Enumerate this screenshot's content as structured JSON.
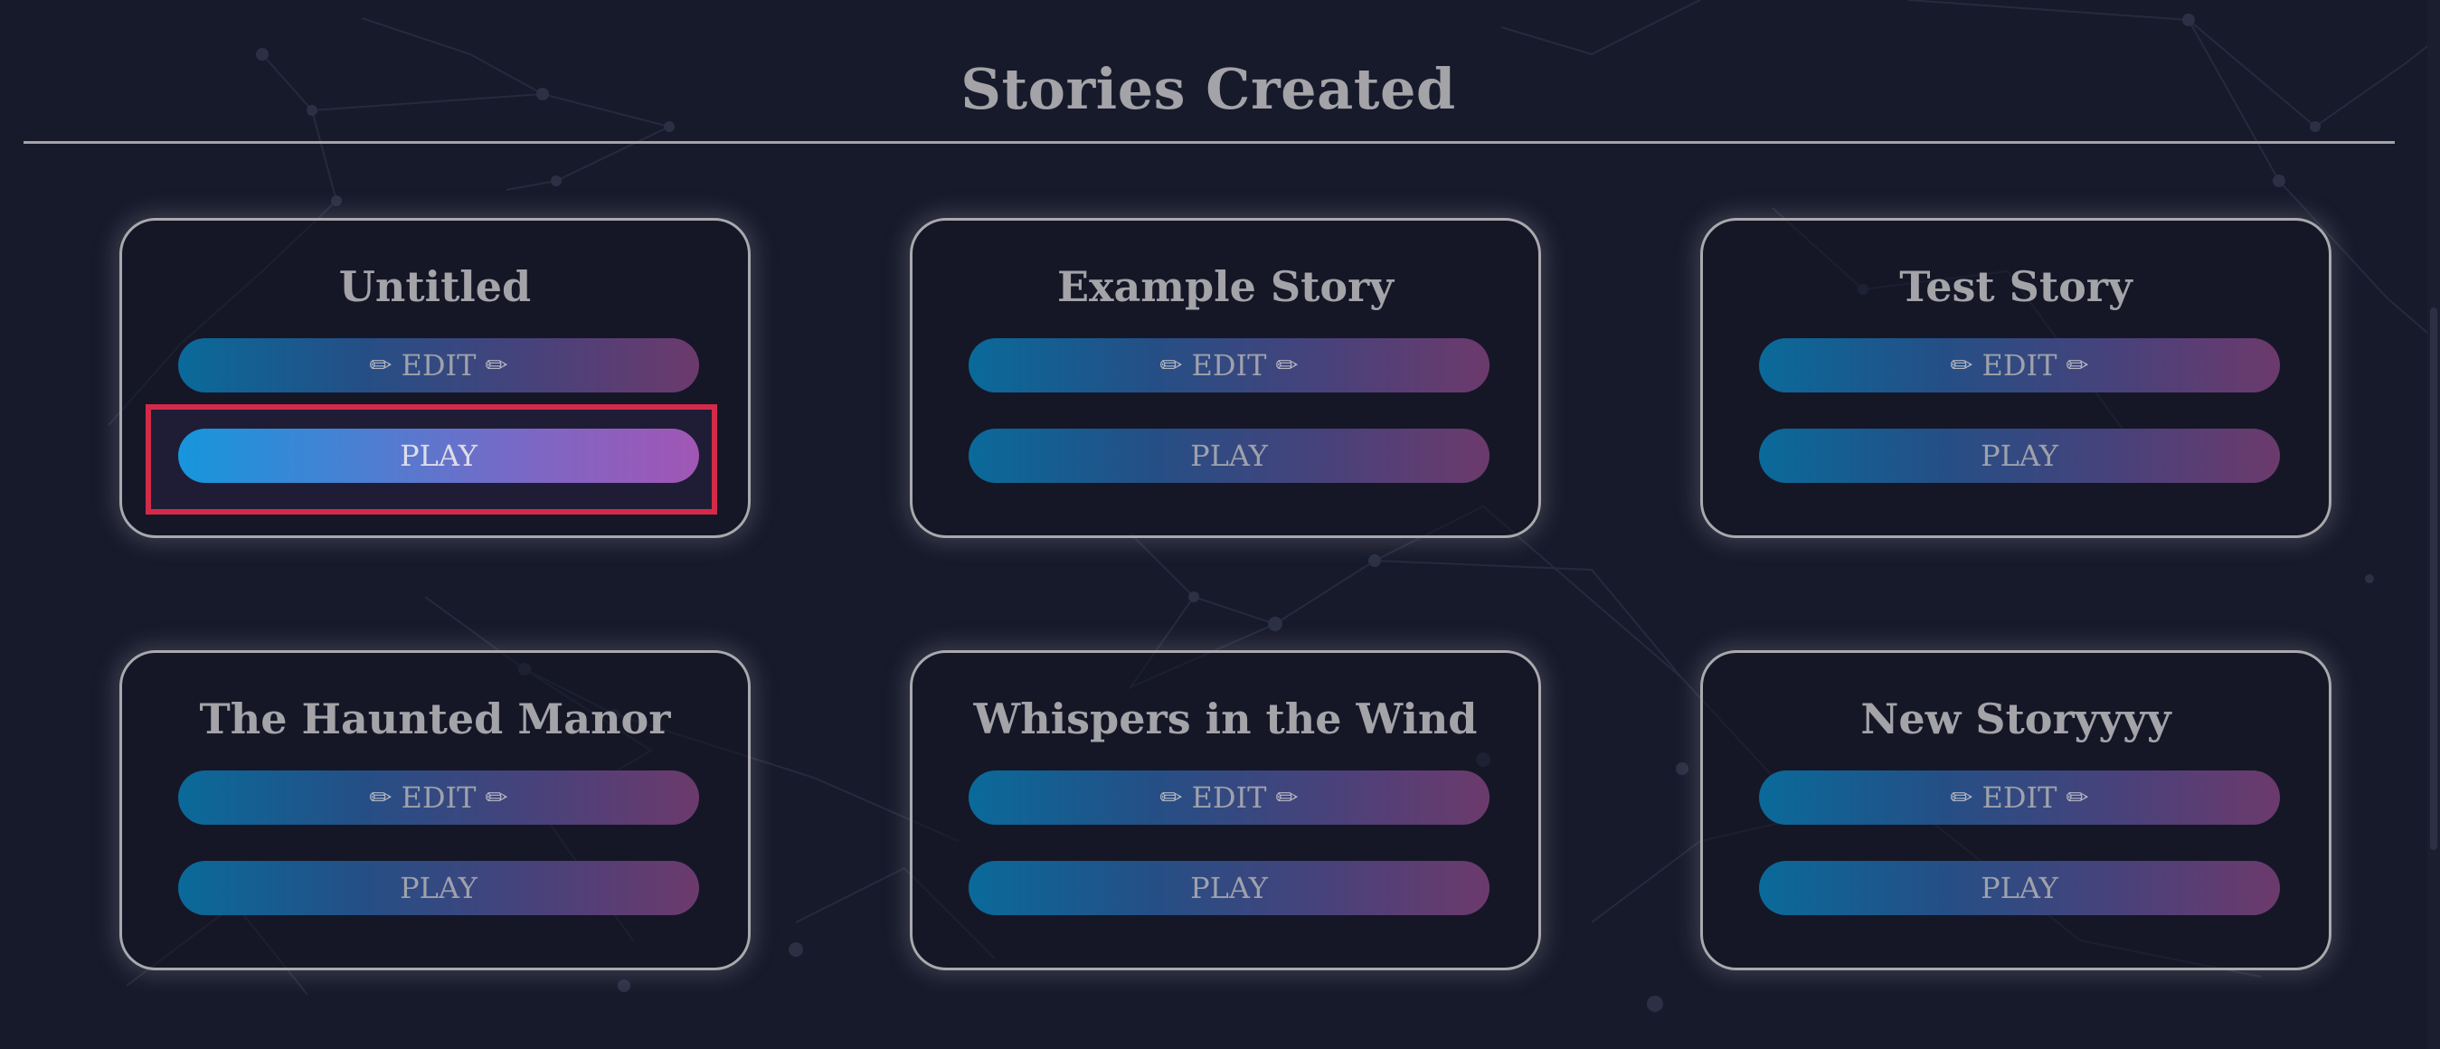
{
  "page": {
    "title": "Stories Created"
  },
  "stories": [
    {
      "title": "Untitled",
      "edit_label": "EDIT",
      "play_label": "PLAY"
    },
    {
      "title": "Example Story",
      "edit_label": "EDIT",
      "play_label": "PLAY"
    },
    {
      "title": "Test Story",
      "edit_label": "EDIT",
      "play_label": "PLAY"
    },
    {
      "title": "The Haunted Manor",
      "edit_label": "EDIT",
      "play_label": "PLAY"
    },
    {
      "title": "Whispers in the Wind",
      "edit_label": "EDIT",
      "play_label": "PLAY"
    },
    {
      "title": "New Storyyyy",
      "edit_label": "EDIT",
      "play_label": "PLAY"
    }
  ],
  "icons": {
    "edit_decoration": "pencil-icon"
  },
  "colors": {
    "background": "#171a2b",
    "text": "#a3a3a8",
    "button_gradient_start": "#0a6a9a",
    "button_gradient_end": "#6c3a6c",
    "active_gradient_start": "#0aaaf2",
    "active_gradient_end": "#b45cc2",
    "highlight": "#d42a4a"
  }
}
